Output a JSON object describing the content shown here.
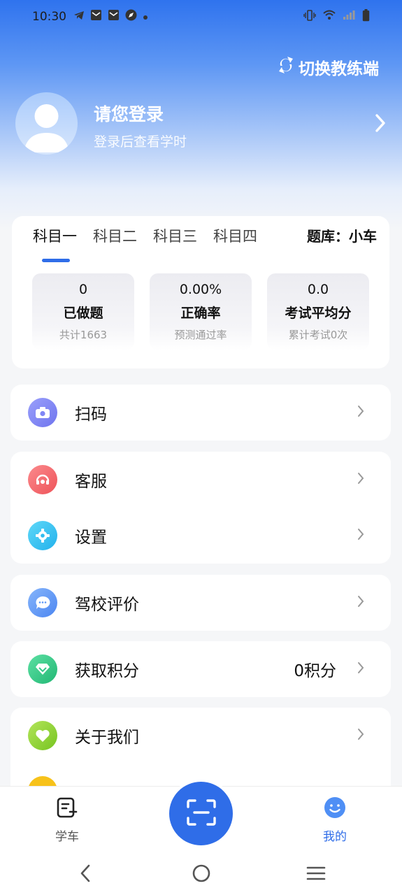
{
  "status_bar": {
    "time": "10:30"
  },
  "header": {
    "switch_label": "切换教练端"
  },
  "profile": {
    "title": "请您登录",
    "subtitle": "登录后查看学时"
  },
  "subjects": {
    "tabs": [
      "科目一",
      "科目二",
      "科目三",
      "科目四"
    ],
    "active_index": 0,
    "bank_label": "题库：小车"
  },
  "stats": [
    {
      "value": "0",
      "label": "已做题",
      "sub": "共计1663"
    },
    {
      "value": "0.00%",
      "label": "正确率",
      "sub": "预测通过率"
    },
    {
      "value": "0.0",
      "label": "考试平均分",
      "sub": "累计考试0次"
    }
  ],
  "menu": {
    "scan": "扫码",
    "service": "客服",
    "settings": "设置",
    "review": "驾校评价",
    "points": "获取积分",
    "points_value": "0积分",
    "about": "关于我们"
  },
  "bottom_nav": {
    "learn": "学车",
    "mine": "我的"
  },
  "colors": {
    "accent": "#2f6de8",
    "scan_icon": "#7f86f5",
    "service_icon": "#f36a6f",
    "settings_icon": "#35c3f2",
    "review_icon": "#5b96f6",
    "points_icon": "#37c98a",
    "about_icon": "#8bd13b"
  }
}
